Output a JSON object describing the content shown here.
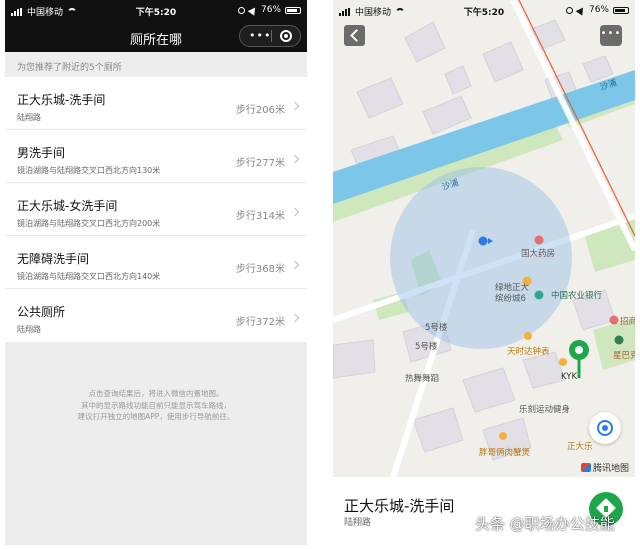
{
  "status_bar": {
    "carrier": "中国移动",
    "time": "下午5:20",
    "battery": "76%"
  },
  "left_screen": {
    "title": "厕所在哪",
    "capsule_more": "•••",
    "section_hint": "为您推荐了附近的5个厕所",
    "items": [
      {
        "name": "正大乐城-洗手间",
        "address": "陆翔路",
        "distance": "步行206米"
      },
      {
        "name": "男洗手间",
        "address": "镜泊湖路与陆翔路交叉口西北方向130米",
        "distance": "步行277米"
      },
      {
        "name": "正大乐城-女洗手间",
        "address": "镜泊湖路与陆翔路交叉口西北方向200米",
        "distance": "步行314米"
      },
      {
        "name": "无障碍洗手间",
        "address": "镜泊湖路与陆翔路交叉口西北方向140米",
        "distance": "步行368米"
      },
      {
        "name": "公共厕所",
        "address": "陆翔路",
        "distance": "步行372米"
      }
    ],
    "footer_lines": [
      "点击查询结果后，将进入微信内置地图。",
      "其中的显示路线功能目前只能显示驾车路线，",
      "建议打开独立的地图APP，使用步行导航前往。"
    ]
  },
  "right_screen": {
    "more_button": "•••",
    "map_labels": {
      "river_1": "沙浦",
      "river_2": "沙浦",
      "pharmacy": "国大药房",
      "lvdi": "绿地正大",
      "lvdi2": "缤纷城6",
      "bank": "中国农业银行",
      "b5_1": "5号楼",
      "b5_2": "5号楼",
      "tianshida": "天时达钟表",
      "kyk": "KYK",
      "reshu": "热舞舞蹈",
      "lezhi": "乐刻运动健身",
      "zhengda": "正大乐",
      "pangge": "胖哥俩肉蟹煲",
      "starbucks": "星巴克",
      "zhaoshang": "招商"
    },
    "attribution": "腾讯地图",
    "place_name": "正大乐城-洗手间",
    "place_address": "陆翔路"
  },
  "watermark": "头条 @职场办公技能",
  "colors": {
    "wechat_green": "#1ea64a",
    "river": "#7cc6ea",
    "location_accent": "#2c7be5"
  }
}
